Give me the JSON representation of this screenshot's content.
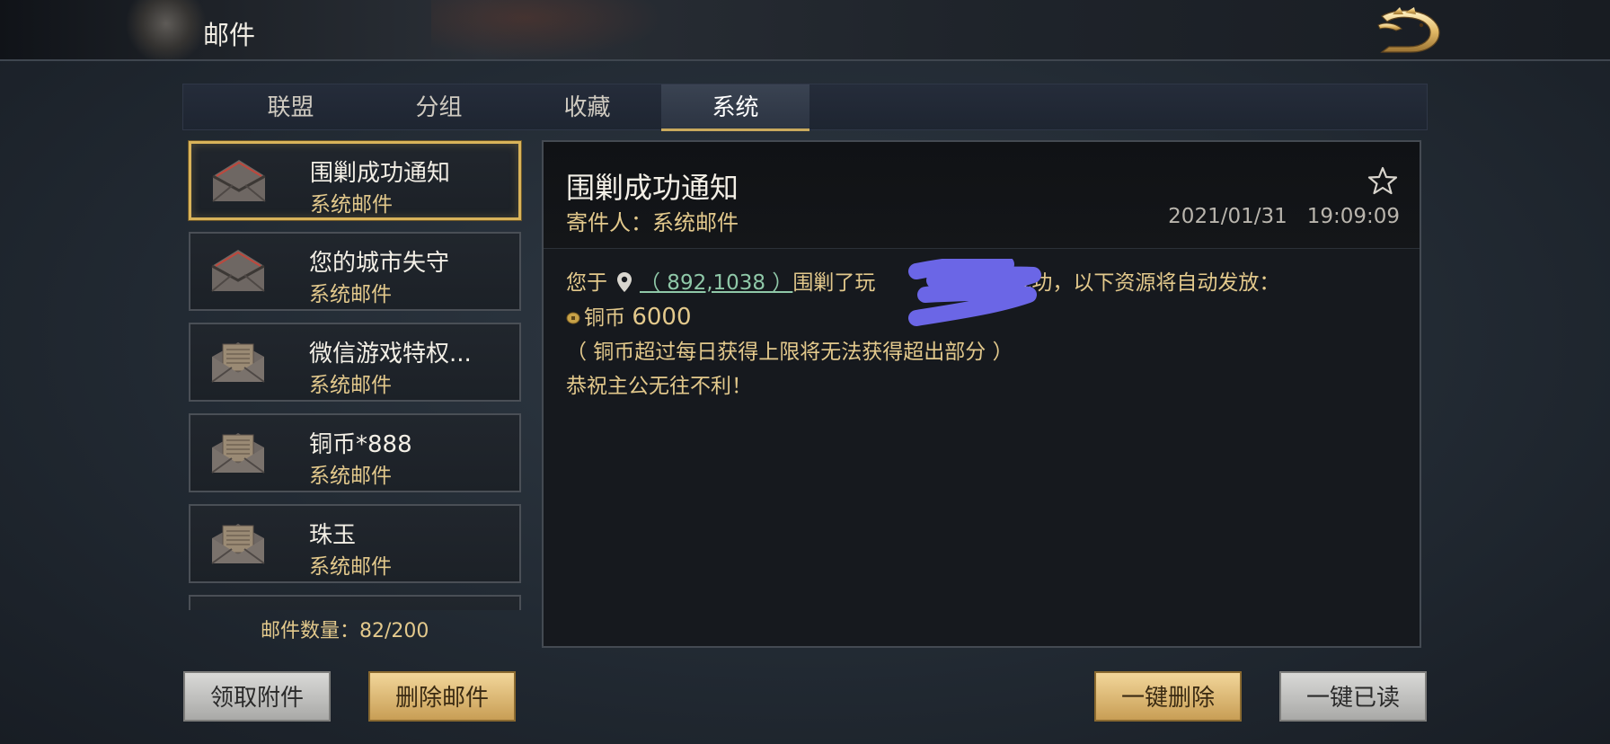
{
  "header": {
    "title": "邮件",
    "close_icon": "dragon-close-icon"
  },
  "tabs": [
    {
      "label": "联盟",
      "active": false
    },
    {
      "label": "分组",
      "active": false
    },
    {
      "label": "收藏",
      "active": false
    },
    {
      "label": "系统",
      "active": true
    }
  ],
  "mail_list": {
    "items": [
      {
        "title": "围剿成功通知",
        "sender": "系统邮件",
        "icon": "open-envelope-icon",
        "selected": true
      },
      {
        "title": "您的城市失守",
        "sender": "系统邮件",
        "icon": "open-envelope-icon",
        "selected": false
      },
      {
        "title": "微信游戏特权...",
        "sender": "系统邮件",
        "icon": "attachment-envelope-icon",
        "selected": false
      },
      {
        "title": "铜币*888",
        "sender": "系统邮件",
        "icon": "attachment-envelope-icon",
        "selected": false
      },
      {
        "title": "珠玉",
        "sender": "系统邮件",
        "icon": "attachment-envelope-icon",
        "selected": false
      }
    ],
    "count_label": "邮件数量：",
    "count_value": "82/200"
  },
  "detail": {
    "title": "围剿成功通知",
    "sender_label": "寄件人：",
    "sender": "系统邮件",
    "date": "2021/01/31",
    "time": "19:09:09",
    "favorite_icon": "star-outline-icon",
    "body": {
      "line1_prefix": "您于",
      "location_link": "（ 892,1038 ）",
      "line1_suffix": "围剿了玩",
      "line1_tail": "营寨成功，以下资源将自动发放：",
      "reward_name": "铜币",
      "reward_amount": "6000",
      "note": "（ 铜币超过每日获得上限将无法获得超出部分 ）",
      "closing": "恭祝主公无往不利！"
    }
  },
  "buttons": {
    "claim_attachments": "领取附件",
    "delete_mail": "删除邮件",
    "delete_all": "一键删除",
    "read_all": "一键已读"
  },
  "colors": {
    "accent_gold": "#d9b35a",
    "sender_text": "#e3c98c",
    "link_green": "#8fc8a8",
    "scribble": "#6b66e6"
  }
}
